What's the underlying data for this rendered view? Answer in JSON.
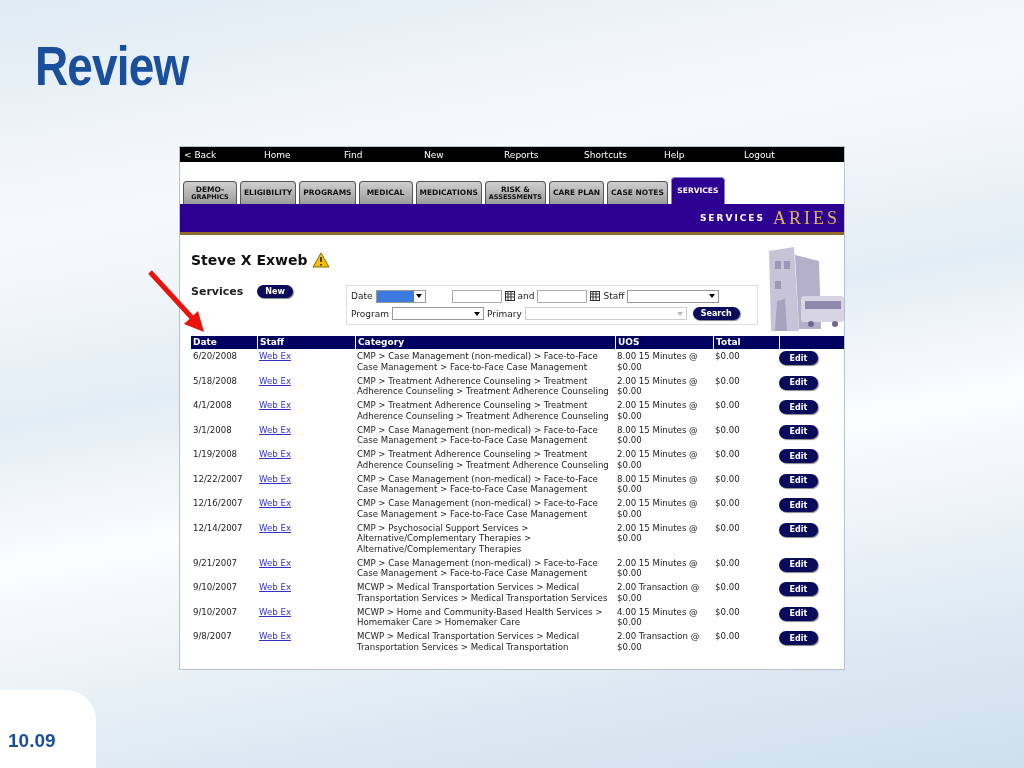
{
  "slide": {
    "title": "Review",
    "page_number": "10.09"
  },
  "app": {
    "nav": [
      "< Back",
      "Home",
      "Find",
      "New",
      "Reports",
      "Shortcuts",
      "Help",
      "Logout"
    ],
    "tabs": [
      {
        "lines": [
          "DEMO-",
          "GRAPHICS"
        ],
        "selected": false
      },
      {
        "lines": [
          "ELIGIBILITY"
        ],
        "selected": false
      },
      {
        "lines": [
          "PROGRAMS"
        ],
        "selected": false
      },
      {
        "lines": [
          "MEDICAL"
        ],
        "selected": false
      },
      {
        "lines": [
          "MEDICATIONS"
        ],
        "selected": false
      },
      {
        "lines": [
          "RISK &",
          "ASSESSMENTS"
        ],
        "selected": false
      },
      {
        "lines": [
          "CARE PLAN"
        ],
        "selected": false
      },
      {
        "lines": [
          "CASE NOTES"
        ],
        "selected": false
      },
      {
        "lines": [
          "SERVICES"
        ],
        "selected": true
      }
    ],
    "banner": {
      "section": "SERVICES",
      "logo": "ARIES"
    },
    "client_name": "Steve X Exweb",
    "section_title": "Services",
    "new_button": "New",
    "filters": {
      "date_label": "Date",
      "and_label": "and",
      "staff_label": "Staff",
      "program_label": "Program",
      "primary_label": "Primary",
      "search_button": "Search"
    },
    "table": {
      "columns": [
        "Date",
        "Staff",
        "Category",
        "UOS",
        "Total"
      ],
      "rows": [
        {
          "date": "6/20/2008",
          "staff": "Web Ex",
          "category": "CMP > Case Management (non-medical) > Face-to-Face Case Management > Face-to-Face Case Management",
          "uos": "8.00 15 Minutes @ $0.00",
          "total": "$0.00",
          "action": "Edit"
        },
        {
          "date": "5/18/2008",
          "staff": "Web Ex",
          "category": "CMP > Treatment Adherence Counseling > Treatment Adherence Counseling > Treatment Adherence Counseling",
          "uos": "2.00 15 Minutes @ $0.00",
          "total": "$0.00",
          "action": "Edit"
        },
        {
          "date": "4/1/2008",
          "staff": "Web Ex",
          "category": "CMP > Treatment Adherence Counseling > Treatment Adherence Counseling > Treatment Adherence Counseling",
          "uos": "2.00 15 Minutes @ $0.00",
          "total": "$0.00",
          "action": "Edit"
        },
        {
          "date": "3/1/2008",
          "staff": "Web Ex",
          "category": "CMP > Case Management (non-medical) > Face-to-Face Case Management > Face-to-Face Case Management",
          "uos": "8.00 15 Minutes @ $0.00",
          "total": "$0.00",
          "action": "Edit"
        },
        {
          "date": "1/19/2008",
          "staff": "Web Ex",
          "category": "CMP > Treatment Adherence Counseling > Treatment Adherence Counseling > Treatment Adherence Counseling",
          "uos": "2.00 15 Minutes @ $0.00",
          "total": "$0.00",
          "action": "Edit"
        },
        {
          "date": "12/22/2007",
          "staff": "Web Ex",
          "category": "CMP > Case Management (non-medical) > Face-to-Face Case Management > Face-to-Face Case Management",
          "uos": "8.00 15 Minutes @ $0.00",
          "total": "$0.00",
          "action": "Edit"
        },
        {
          "date": "12/16/2007",
          "staff": "Web Ex",
          "category": "CMP > Case Management (non-medical) > Face-to-Face Case Management > Face-to-Face Case Management",
          "uos": "2.00 15 Minutes @ $0.00",
          "total": "$0.00",
          "action": "Edit"
        },
        {
          "date": "12/14/2007",
          "staff": "Web Ex",
          "category": "CMP > Psychosocial Support Services > Alternative/Complementary Therapies > Alternative/Complementary Therapies",
          "uos": "2.00 15 Minutes @ $0.00",
          "total": "$0.00",
          "action": "Edit"
        },
        {
          "date": "9/21/2007",
          "staff": "Web Ex",
          "category": "CMP > Case Management (non-medical) > Face-to-Face Case Management > Face-to-Face Case Management",
          "uos": "2.00 15 Minutes @ $0.00",
          "total": "$0.00",
          "action": "Edit"
        },
        {
          "date": "9/10/2007",
          "staff": "Web Ex",
          "category": "MCWP > Medical Transportation Services > Medical Transportation Services > Medical Transportation Services",
          "uos": "2.00 Transaction @ $0.00",
          "total": "$0.00",
          "action": "Edit"
        },
        {
          "date": "9/10/2007",
          "staff": "Web Ex",
          "category": "MCWP > Home and Community-Based Health Services > Homemaker Care > Homemaker Care",
          "uos": "4.00 15 Minutes @ $0.00",
          "total": "$0.00",
          "action": "Edit"
        },
        {
          "date": "9/8/2007",
          "staff": "Web Ex",
          "category": "MCWP > Medical Transportation Services > Medical Transportation Services > Medical Transportation",
          "uos": "2.00 Transaction @ $0.00",
          "total": "$0.00",
          "action": "Edit"
        }
      ]
    }
  }
}
